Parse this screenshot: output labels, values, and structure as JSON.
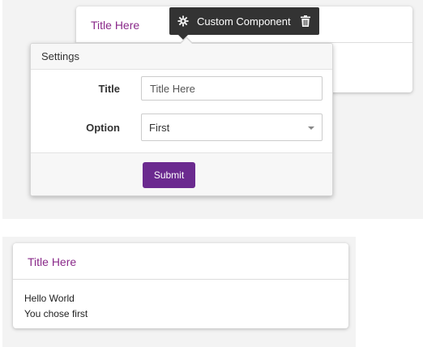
{
  "preview_card": {
    "title": "Title Here"
  },
  "toolbar": {
    "label": "Custom Component",
    "settings_icon": "gear-icon",
    "delete_icon": "trash-icon"
  },
  "settings_panel": {
    "header": "Settings",
    "title_label": "Title",
    "title_value": "Title Here",
    "option_label": "Option",
    "option_value": "First",
    "submit_label": "Submit"
  },
  "rendered_card": {
    "title": "Title Here",
    "line1": "Hello World",
    "line2": "You chose first"
  },
  "colors": {
    "title": "#8a2a8a",
    "submit": "#6b2a8f",
    "toolbar": "#333333"
  }
}
